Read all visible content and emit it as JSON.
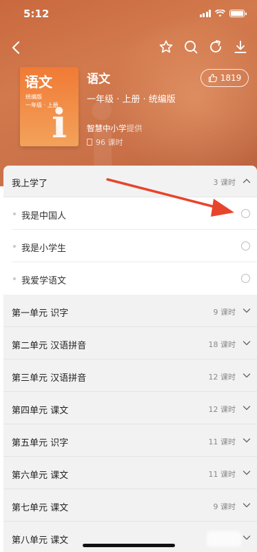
{
  "status_bar": {
    "time": "5:12"
  },
  "nav": {
    "back_icon": "chevron-left-icon",
    "actions": [
      "star-icon",
      "search-icon",
      "refresh-icon",
      "download-icon"
    ]
  },
  "book": {
    "cover_title": "语文",
    "cover_line1": "统编版",
    "cover_line2": "一年级 · 上册",
    "cover_glyph": "i",
    "title": "语文",
    "meta": "一年级 · 上册 · 统编版",
    "provider_name": "智慧中小学",
    "provider_suffix": "提供",
    "lessons": "96 课时"
  },
  "like": {
    "count": "1819",
    "icon": "thumbs-up-icon"
  },
  "accent_color": "#e8442c",
  "sections": [
    {
      "title": "我上学了",
      "count": "3 课时",
      "expanded": true,
      "lessons": [
        "我是中国人",
        "我是小学生",
        "我爱学语文"
      ]
    },
    {
      "title": "第一单元 识字",
      "count": "9 课时"
    },
    {
      "title": "第二单元 汉语拼音",
      "count": "18 课时"
    },
    {
      "title": "第三单元 汉语拼音",
      "count": "12 课时"
    },
    {
      "title": "第四单元 课文",
      "count": "12 课时"
    },
    {
      "title": "第五单元 识字",
      "count": "11 课时"
    },
    {
      "title": "第六单元 课文",
      "count": "11 课时"
    },
    {
      "title": "第七单元 课文",
      "count": "9 课时"
    },
    {
      "title": "第八单元 课文",
      "count": ""
    }
  ]
}
